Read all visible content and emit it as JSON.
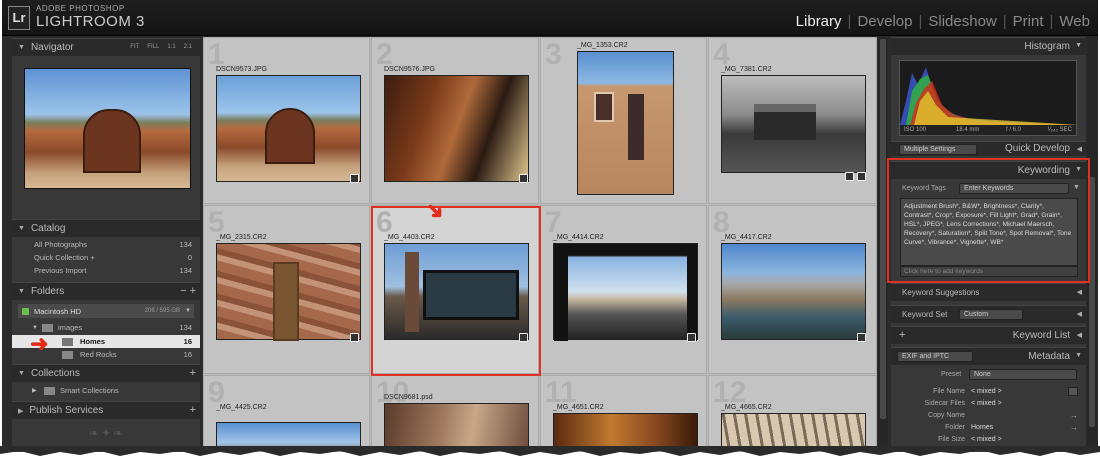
{
  "app": {
    "logo": "Lr",
    "brand_top": "ADOBE PHOTOSHOP",
    "brand_main": "LIGHTROOM 3"
  },
  "modules": [
    "Library",
    "Develop",
    "Slideshow",
    "Print",
    "Web"
  ],
  "navigator": {
    "title": "Navigator",
    "buttons": [
      "FIT",
      "FILL",
      "1:1",
      "2:1"
    ]
  },
  "catalog": {
    "title": "Catalog",
    "items": [
      {
        "label": "All Photographs",
        "count": "134"
      },
      {
        "label": "Quick Collection  +",
        "count": "0"
      },
      {
        "label": "Previous Import",
        "count": "134"
      }
    ]
  },
  "folders": {
    "title": "Folders",
    "drive": {
      "label": "Macintosh HD",
      "info": "206 / 595 GB"
    },
    "items": [
      {
        "label": "images",
        "count": "134"
      },
      {
        "label": "Homes",
        "count": "16"
      },
      {
        "label": "Red Rocks",
        "count": "16"
      }
    ]
  },
  "collections": {
    "title": "Collections",
    "items": [
      {
        "label": "Smart Collections"
      }
    ]
  },
  "publish": {
    "title": "Publish Services"
  },
  "grid": [
    {
      "num": "1",
      "name": "DSCN9573.JPG"
    },
    {
      "num": "2",
      "name": "DSCN9576.JPG"
    },
    {
      "num": "3",
      "name": "_MG_1353.CR2"
    },
    {
      "num": "4",
      "name": "_MG_7381.CR2"
    },
    {
      "num": "5",
      "name": "_MG_2315.CR2"
    },
    {
      "num": "6",
      "name": "_MG_4403.CR2"
    },
    {
      "num": "7",
      "name": "_MG_4414.CR2"
    },
    {
      "num": "8",
      "name": "_MG_4417.CR2"
    },
    {
      "num": "9",
      "name": "_MG_4425.CR2"
    },
    {
      "num": "10",
      "name": "DSCN9681.psd"
    },
    {
      "num": "11",
      "name": "_MG_4651.CR2"
    },
    {
      "num": "12",
      "name": "_MG_4665.CR2"
    }
  ],
  "histogram": {
    "title": "Histogram",
    "iso": "ISO 100",
    "focal": "18.4 mm",
    "aperture": "f / 6.0",
    "shutter": "¹⁄₂₄₀ SEC"
  },
  "quick_develop": {
    "title": "Quick Develop",
    "preset": "Multiple Settings"
  },
  "keywording": {
    "title": "Keywording",
    "tags_label": "Keyword Tags",
    "tags_mode": "Enter Keywords",
    "keywords": "Adjustment Brush*, B&W*, Brightness*, Clarity*, Contrast*, Crop*, Exposure*, Fill Light*, Grad*, Grain*, HSL*, JPEG*, Lens Corrections*, Michael Maersch, Recovery*, Saturation*, Split Tone*, Spot Removal*, Tone Curve*, Vibrance*, Vignette*, WB*",
    "add_placeholder": "Click here to add keywords"
  },
  "keyword_suggestions": {
    "title": "Keyword Suggestions"
  },
  "keyword_set": {
    "label": "Keyword Set",
    "value": "Custom"
  },
  "keyword_list": {
    "title": "Keyword List"
  },
  "metadata": {
    "title": "Metadata",
    "mode": "EXIF and IPTC",
    "preset_label": "Preset",
    "preset_value": "None",
    "fields": [
      {
        "label": "File Name",
        "value": "< mixed >"
      },
      {
        "label": "Sidecar Files",
        "value": "< mixed >"
      },
      {
        "label": "Copy Name",
        "value": ""
      },
      {
        "label": "Folder",
        "value": "Homes"
      },
      {
        "label": "File Size",
        "value": "< mixed >"
      }
    ]
  },
  "colors": {
    "highlight": "#e03020",
    "panel": "#383838",
    "grid_bg": "#bdbdbd"
  }
}
